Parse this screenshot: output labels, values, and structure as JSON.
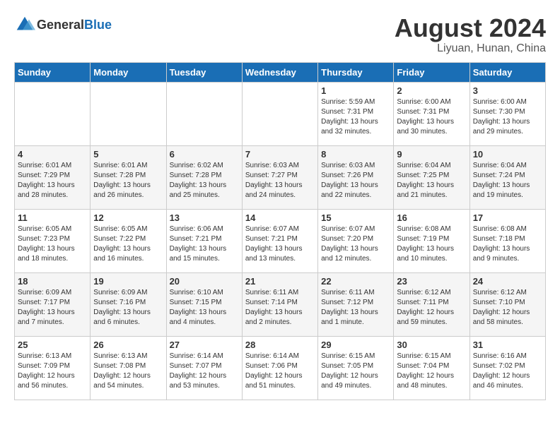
{
  "header": {
    "logo": {
      "general": "General",
      "blue": "Blue"
    },
    "month_year": "August 2024",
    "location": "Liyuan, Hunan, China"
  },
  "days_of_week": [
    "Sunday",
    "Monday",
    "Tuesday",
    "Wednesday",
    "Thursday",
    "Friday",
    "Saturday"
  ],
  "weeks": [
    [
      {
        "day": "",
        "info": ""
      },
      {
        "day": "",
        "info": ""
      },
      {
        "day": "",
        "info": ""
      },
      {
        "day": "",
        "info": ""
      },
      {
        "day": "1",
        "info": "Sunrise: 5:59 AM\nSunset: 7:31 PM\nDaylight: 13 hours\nand 32 minutes."
      },
      {
        "day": "2",
        "info": "Sunrise: 6:00 AM\nSunset: 7:31 PM\nDaylight: 13 hours\nand 30 minutes."
      },
      {
        "day": "3",
        "info": "Sunrise: 6:00 AM\nSunset: 7:30 PM\nDaylight: 13 hours\nand 29 minutes."
      }
    ],
    [
      {
        "day": "4",
        "info": "Sunrise: 6:01 AM\nSunset: 7:29 PM\nDaylight: 13 hours\nand 28 minutes."
      },
      {
        "day": "5",
        "info": "Sunrise: 6:01 AM\nSunset: 7:28 PM\nDaylight: 13 hours\nand 26 minutes."
      },
      {
        "day": "6",
        "info": "Sunrise: 6:02 AM\nSunset: 7:28 PM\nDaylight: 13 hours\nand 25 minutes."
      },
      {
        "day": "7",
        "info": "Sunrise: 6:03 AM\nSunset: 7:27 PM\nDaylight: 13 hours\nand 24 minutes."
      },
      {
        "day": "8",
        "info": "Sunrise: 6:03 AM\nSunset: 7:26 PM\nDaylight: 13 hours\nand 22 minutes."
      },
      {
        "day": "9",
        "info": "Sunrise: 6:04 AM\nSunset: 7:25 PM\nDaylight: 13 hours\nand 21 minutes."
      },
      {
        "day": "10",
        "info": "Sunrise: 6:04 AM\nSunset: 7:24 PM\nDaylight: 13 hours\nand 19 minutes."
      }
    ],
    [
      {
        "day": "11",
        "info": "Sunrise: 6:05 AM\nSunset: 7:23 PM\nDaylight: 13 hours\nand 18 minutes."
      },
      {
        "day": "12",
        "info": "Sunrise: 6:05 AM\nSunset: 7:22 PM\nDaylight: 13 hours\nand 16 minutes."
      },
      {
        "day": "13",
        "info": "Sunrise: 6:06 AM\nSunset: 7:21 PM\nDaylight: 13 hours\nand 15 minutes."
      },
      {
        "day": "14",
        "info": "Sunrise: 6:07 AM\nSunset: 7:21 PM\nDaylight: 13 hours\nand 13 minutes."
      },
      {
        "day": "15",
        "info": "Sunrise: 6:07 AM\nSunset: 7:20 PM\nDaylight: 13 hours\nand 12 minutes."
      },
      {
        "day": "16",
        "info": "Sunrise: 6:08 AM\nSunset: 7:19 PM\nDaylight: 13 hours\nand 10 minutes."
      },
      {
        "day": "17",
        "info": "Sunrise: 6:08 AM\nSunset: 7:18 PM\nDaylight: 13 hours\nand 9 minutes."
      }
    ],
    [
      {
        "day": "18",
        "info": "Sunrise: 6:09 AM\nSunset: 7:17 PM\nDaylight: 13 hours\nand 7 minutes."
      },
      {
        "day": "19",
        "info": "Sunrise: 6:09 AM\nSunset: 7:16 PM\nDaylight: 13 hours\nand 6 minutes."
      },
      {
        "day": "20",
        "info": "Sunrise: 6:10 AM\nSunset: 7:15 PM\nDaylight: 13 hours\nand 4 minutes."
      },
      {
        "day": "21",
        "info": "Sunrise: 6:11 AM\nSunset: 7:14 PM\nDaylight: 13 hours\nand 2 minutes."
      },
      {
        "day": "22",
        "info": "Sunrise: 6:11 AM\nSunset: 7:12 PM\nDaylight: 13 hours\nand 1 minute."
      },
      {
        "day": "23",
        "info": "Sunrise: 6:12 AM\nSunset: 7:11 PM\nDaylight: 12 hours\nand 59 minutes."
      },
      {
        "day": "24",
        "info": "Sunrise: 6:12 AM\nSunset: 7:10 PM\nDaylight: 12 hours\nand 58 minutes."
      }
    ],
    [
      {
        "day": "25",
        "info": "Sunrise: 6:13 AM\nSunset: 7:09 PM\nDaylight: 12 hours\nand 56 minutes."
      },
      {
        "day": "26",
        "info": "Sunrise: 6:13 AM\nSunset: 7:08 PM\nDaylight: 12 hours\nand 54 minutes."
      },
      {
        "day": "27",
        "info": "Sunrise: 6:14 AM\nSunset: 7:07 PM\nDaylight: 12 hours\nand 53 minutes."
      },
      {
        "day": "28",
        "info": "Sunrise: 6:14 AM\nSunset: 7:06 PM\nDaylight: 12 hours\nand 51 minutes."
      },
      {
        "day": "29",
        "info": "Sunrise: 6:15 AM\nSunset: 7:05 PM\nDaylight: 12 hours\nand 49 minutes."
      },
      {
        "day": "30",
        "info": "Sunrise: 6:15 AM\nSunset: 7:04 PM\nDaylight: 12 hours\nand 48 minutes."
      },
      {
        "day": "31",
        "info": "Sunrise: 6:16 AM\nSunset: 7:02 PM\nDaylight: 12 hours\nand 46 minutes."
      }
    ]
  ]
}
